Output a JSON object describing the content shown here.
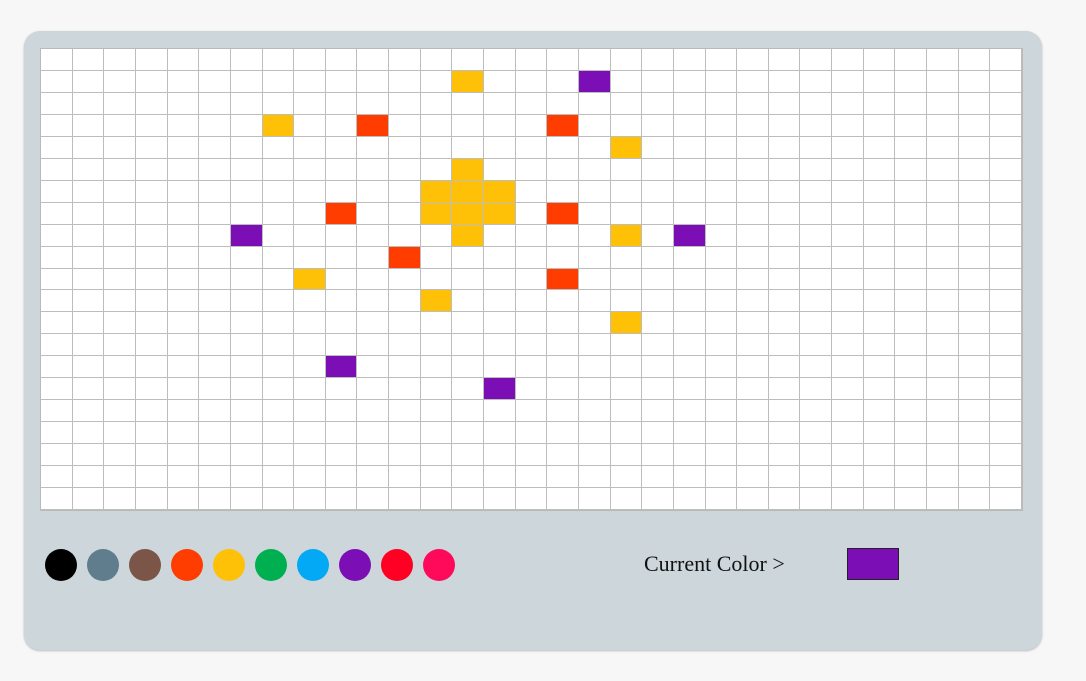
{
  "grid": {
    "rows": 21,
    "cols": 31,
    "empty_color": "#ffffff",
    "painted": [
      {
        "r": 1,
        "c": 13,
        "color": "#ffc107"
      },
      {
        "r": 1,
        "c": 17,
        "color": "#7b0fb5"
      },
      {
        "r": 3,
        "c": 7,
        "color": "#ffc107"
      },
      {
        "r": 3,
        "c": 10,
        "color": "#ff3d00"
      },
      {
        "r": 3,
        "c": 16,
        "color": "#ff3d00"
      },
      {
        "r": 4,
        "c": 18,
        "color": "#ffc107"
      },
      {
        "r": 5,
        "c": 13,
        "color": "#ffc107"
      },
      {
        "r": 6,
        "c": 12,
        "color": "#ffc107"
      },
      {
        "r": 6,
        "c": 13,
        "color": "#ffc107"
      },
      {
        "r": 6,
        "c": 14,
        "color": "#ffc107"
      },
      {
        "r": 7,
        "c": 9,
        "color": "#ff3d00"
      },
      {
        "r": 7,
        "c": 12,
        "color": "#ffc107"
      },
      {
        "r": 7,
        "c": 13,
        "color": "#ffc107"
      },
      {
        "r": 7,
        "c": 14,
        "color": "#ffc107"
      },
      {
        "r": 7,
        "c": 16,
        "color": "#ff3d00"
      },
      {
        "r": 8,
        "c": 6,
        "color": "#7b0fb5"
      },
      {
        "r": 8,
        "c": 13,
        "color": "#ffc107"
      },
      {
        "r": 8,
        "c": 18,
        "color": "#ffc107"
      },
      {
        "r": 8,
        "c": 20,
        "color": "#7b0fb5"
      },
      {
        "r": 9,
        "c": 11,
        "color": "#ff3d00"
      },
      {
        "r": 10,
        "c": 8,
        "color": "#ffc107"
      },
      {
        "r": 10,
        "c": 16,
        "color": "#ff3d00"
      },
      {
        "r": 11,
        "c": 12,
        "color": "#ffc107"
      },
      {
        "r": 12,
        "c": 18,
        "color": "#ffc107"
      },
      {
        "r": 14,
        "c": 9,
        "color": "#7b0fb5"
      },
      {
        "r": 15,
        "c": 14,
        "color": "#7b0fb5"
      }
    ]
  },
  "palette": [
    {
      "name": "black",
      "color": "#000000"
    },
    {
      "name": "blue-grey",
      "color": "#5f7d8c"
    },
    {
      "name": "brown",
      "color": "#7b5548"
    },
    {
      "name": "deep-orange",
      "color": "#ff3d00"
    },
    {
      "name": "amber",
      "color": "#ffc107"
    },
    {
      "name": "green",
      "color": "#00b050"
    },
    {
      "name": "light-blue",
      "color": "#03a9f4"
    },
    {
      "name": "purple",
      "color": "#7b0fb5"
    },
    {
      "name": "red",
      "color": "#ff0022"
    },
    {
      "name": "pink",
      "color": "#ff0a5b"
    }
  ],
  "current": {
    "label": "Current Color >",
    "color": "#7b0fb5"
  }
}
